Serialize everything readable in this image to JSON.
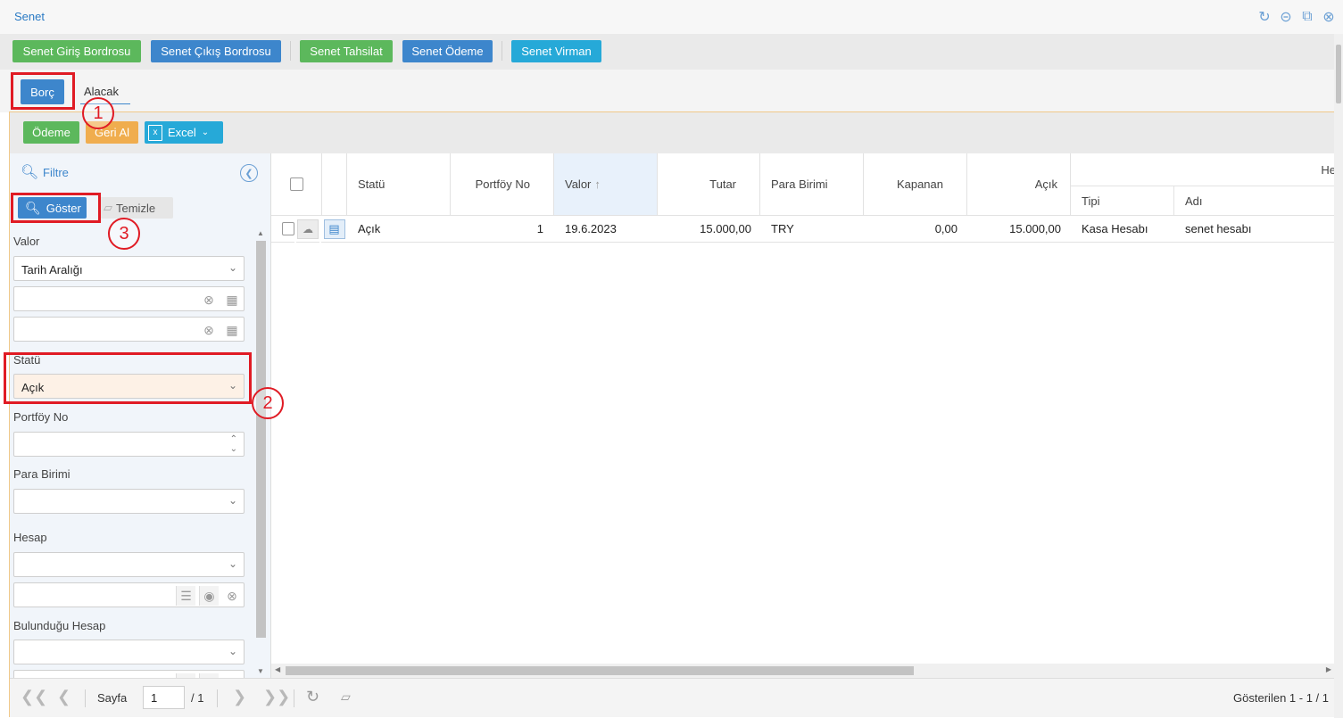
{
  "window": {
    "title": "Senet"
  },
  "toolbar": {
    "buttons": [
      {
        "label": "Senet Giriş Bordrosu",
        "color": "#5cb85c"
      },
      {
        "label": "Senet Çıkış Bordrosu",
        "color": "#3d86cc"
      },
      {
        "label": "Senet Tahsilat",
        "color": "#5cb85c"
      },
      {
        "label": "Senet Ödeme",
        "color": "#3d86cc"
      },
      {
        "label": "Senet Virman",
        "color": "#26a9d8"
      }
    ]
  },
  "tabs": [
    {
      "label": "Borç",
      "active": true
    },
    {
      "label": "Alacak",
      "active": false
    }
  ],
  "actions": {
    "odeme": "Ödeme",
    "geri_al": "Geri Al",
    "excel": "Excel"
  },
  "filter": {
    "title": "Filtre",
    "show_button": "Göster",
    "clear_button": "Temizle",
    "fields": {
      "valor": {
        "label": "Valor",
        "selected": "Tarih Aralığı"
      },
      "statu": {
        "label": "Statü",
        "selected": "Açık"
      },
      "portfoy_no": {
        "label": "Portföy No"
      },
      "para_birimi": {
        "label": "Para Birimi"
      },
      "hesap": {
        "label": "Hesap"
      },
      "bulundugu_hesap": {
        "label": "Bulunduğu Hesap"
      }
    }
  },
  "grid": {
    "columns": {
      "statu": "Statü",
      "portfoy_no": "Portföy No",
      "valor": "Valor",
      "tutar": "Tutar",
      "para_birimi": "Para Birimi",
      "kapanan": "Kapanan",
      "acik": "Açık",
      "hesap_group": "Hesap",
      "tipi": "Tipi",
      "adi": "Adı"
    },
    "sort": {
      "column": "Valor",
      "direction": "asc"
    },
    "rows": [
      {
        "statu": "Açık",
        "portfoy_no": "1",
        "valor": "19.6.2023",
        "tutar": "15.000,00",
        "para_birimi": "TRY",
        "kapanan": "0,00",
        "acik": "15.000,00",
        "tipi": "Kasa Hesabı",
        "adi": "senet hesabı"
      }
    ]
  },
  "pager": {
    "page_label": "Sayfa",
    "page_value": "1",
    "total_pages": "/ 1",
    "summary": "Gösterilen 1 - 1 / 1"
  },
  "annotations": {
    "marker_1": "1",
    "marker_2": "2",
    "marker_3": "3",
    "color": "#e01b24"
  },
  "colors": {
    "accent_blue": "#3d86cc",
    "green": "#5cb85c",
    "orange": "#f0ad4e",
    "cyan": "#26a9d8"
  }
}
